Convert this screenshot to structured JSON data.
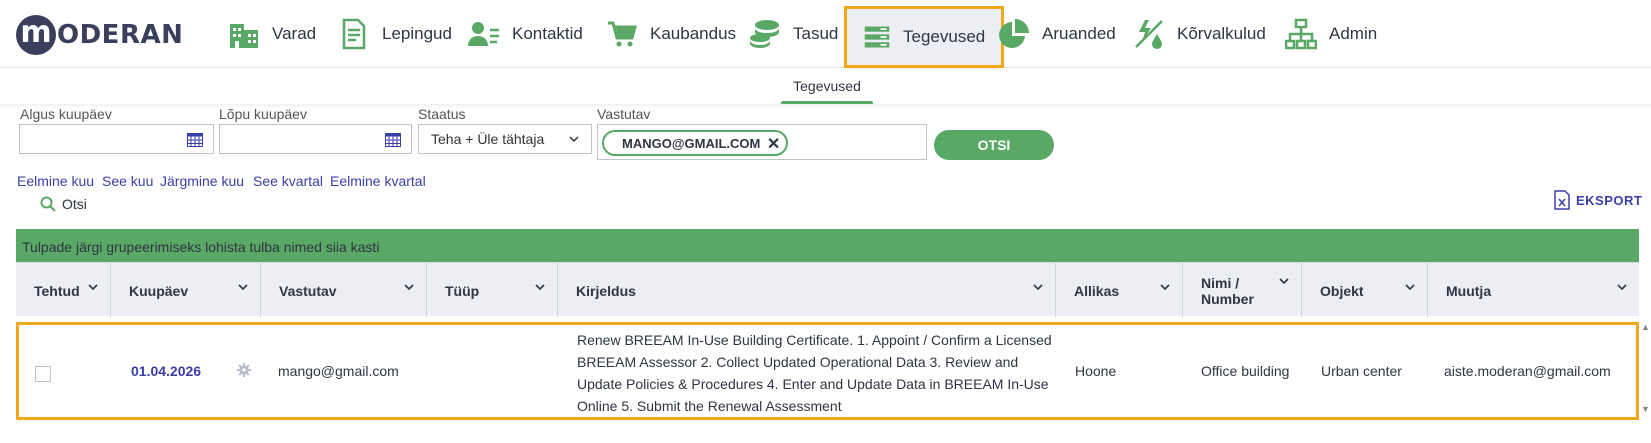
{
  "brand": {
    "logo_letter": "m",
    "logo_text": "ODERAN"
  },
  "nav": [
    {
      "label": "Varad",
      "icon": "building-icon"
    },
    {
      "label": "Lepingud",
      "icon": "document-icon"
    },
    {
      "label": "Kontaktid",
      "icon": "contact-icon"
    },
    {
      "label": "Kaubandus",
      "icon": "cart-icon"
    },
    {
      "label": "Tasud",
      "icon": "coins-icon"
    },
    {
      "label": "Tegevused",
      "icon": "tasks-icon",
      "active": true
    },
    {
      "label": "Aruanded",
      "icon": "pie-chart-icon"
    },
    {
      "label": "Kõrvalkulud",
      "icon": "utilities-icon"
    },
    {
      "label": "Admin",
      "icon": "org-chart-icon"
    }
  ],
  "subtab": {
    "label": "Tegevused"
  },
  "filters": {
    "start_label": "Algus kuupäev",
    "start_value": "",
    "end_label": "Lõpu kuupäev",
    "end_value": "",
    "status_label": "Staatus",
    "status_value": "Teha + Üle tähtaja",
    "responsible_label": "Vastutav",
    "responsible_chip": "MANGO@GMAIL.COM",
    "search_button": "OTSI"
  },
  "quick_links": [
    "Eelmine kuu",
    "See kuu",
    "Järgmine kuu",
    "See kvartal",
    "Eelmine kvartal"
  ],
  "search_label": "Otsi",
  "export_label": "EKSPORT",
  "group_bar_text": "Tulpade järgi grupeerimiseks lohista tulba nimed siia kasti",
  "columns": {
    "done": "Tehtud",
    "date": "Kuupäev",
    "responsible": "Vastutav",
    "type": "Tüüp",
    "description": "Kirjeldus",
    "source": "Allikas",
    "name_line1": "Nimi /",
    "name_line2": "Number",
    "object": "Objekt",
    "modifier": "Muutja"
  },
  "rows": [
    {
      "done": false,
      "date": "01.04.2026",
      "responsible": "mango@gmail.com",
      "type": "",
      "description": "Renew BREEAM In-Use Building Certificate. 1. Appoint / Confirm a Licensed BREEAM Assessor 2. Collect Updated Operational Data 3. Review and Update Policies & Procedures 4. Enter and Update Data in BREEAM In-Use Online 5. Submit the Renewal Assessment",
      "source": "Hoone",
      "name": "Office building",
      "object": "Urban center",
      "modifier": "aiste.moderan@gmail.com"
    }
  ],
  "colors": {
    "accent_green": "#5aa865",
    "highlight_orange": "#f3a81c",
    "link_blue": "#3a3fa8",
    "brand_navy": "#3a3f5c"
  }
}
